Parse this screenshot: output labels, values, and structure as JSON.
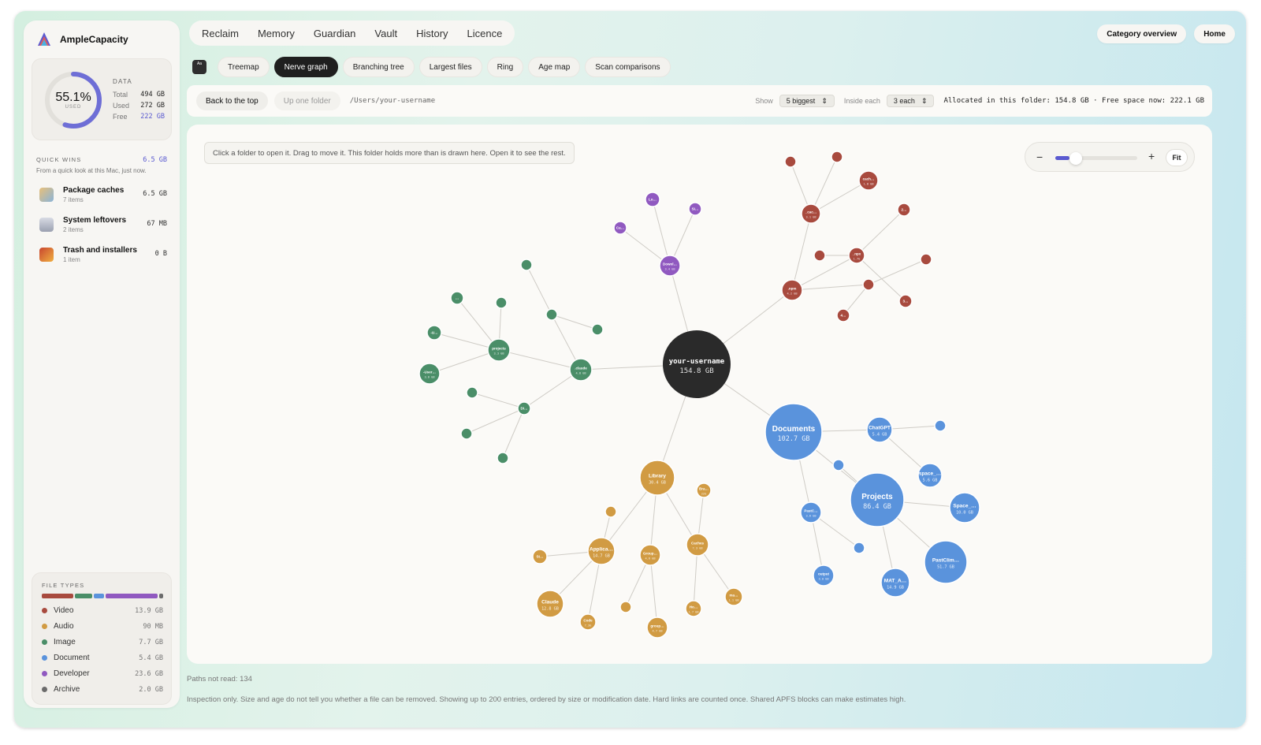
{
  "app": {
    "name": "AmpleCapacity"
  },
  "data_card": {
    "percent": "55.1%",
    "used_caption": "USED",
    "percent_value": 55.1,
    "heading": "DATA",
    "rows": [
      {
        "k": "Total",
        "v": "494 GB"
      },
      {
        "k": "Used",
        "v": "272 GB"
      },
      {
        "k": "Free",
        "v": "222 GB"
      }
    ]
  },
  "quick_wins": {
    "heading": "QUICK WINS",
    "amount": "6.5 GB",
    "subtitle": "From a quick look at this Mac, just now.",
    "items": [
      {
        "title": "Package caches",
        "count": "7 items",
        "size": "6.5 GB",
        "icon": "package-icon"
      },
      {
        "title": "System leftovers",
        "count": "2 items",
        "size": "67 MB",
        "icon": "leftovers-icon"
      },
      {
        "title": "Trash and installers",
        "count": "1 item",
        "size": "0 B",
        "icon": "trash-icon"
      }
    ]
  },
  "file_types": {
    "heading": "FILE TYPES",
    "items": [
      {
        "label": "Video",
        "size": "13.9 GB",
        "color": "#a84a3e"
      },
      {
        "label": "Audio",
        "size": "90 MB",
        "color": "#d19b43"
      },
      {
        "label": "Image",
        "size": "7.7 GB",
        "color": "#4a8e68"
      },
      {
        "label": "Document",
        "size": "5.4 GB",
        "color": "#5a93dc"
      },
      {
        "label": "Developer",
        "size": "23.6 GB",
        "color": "#9059c0"
      },
      {
        "label": "Archive",
        "size": "2.0 GB",
        "color": "#6b6b6b"
      }
    ]
  },
  "nav": {
    "tabs": [
      "Reclaim",
      "Memory",
      "Guardian",
      "Vault",
      "History",
      "Licence"
    ],
    "right": [
      "Category overview",
      "Home"
    ]
  },
  "views": {
    "chip": "Aa",
    "tabs": [
      "Treemap",
      "Nerve graph",
      "Branching tree",
      "Largest files",
      "Ring",
      "Age map",
      "Scan comparisons"
    ],
    "active": "Nerve graph"
  },
  "pathbar": {
    "back": "Back to the top",
    "up": "Up one folder",
    "path": "/Users/your-username",
    "show_label": "Show",
    "show_value": "5 biggest",
    "inside_label": "Inside each",
    "inside_value": "3 each",
    "allocated": "Allocated in this folder: 154.8 GB · Free space now: 222.1 GB"
  },
  "graph": {
    "hint": "Click a folder to open it. Drag to move it. This folder holds more than is drawn here. Open it to see the rest.",
    "zoom": {
      "minus": "−",
      "plus": "+",
      "fit": "Fit",
      "level": 0.17
    },
    "colors": {
      "root": "#2a2a2a",
      "red": "#a84a3e",
      "green": "#4a8e68",
      "purple": "#9059c0",
      "orange": "#d19b43",
      "blue": "#5a93dc"
    }
  },
  "footer": {
    "paths": "Paths not read: 134",
    "note": "Inspection only. Size and age do not tell you whether a file can be removed. Showing up to 200 entries, ordered by size or modification date. Hard links are counted once. Shared APFS blocks can make estimates high."
  }
}
